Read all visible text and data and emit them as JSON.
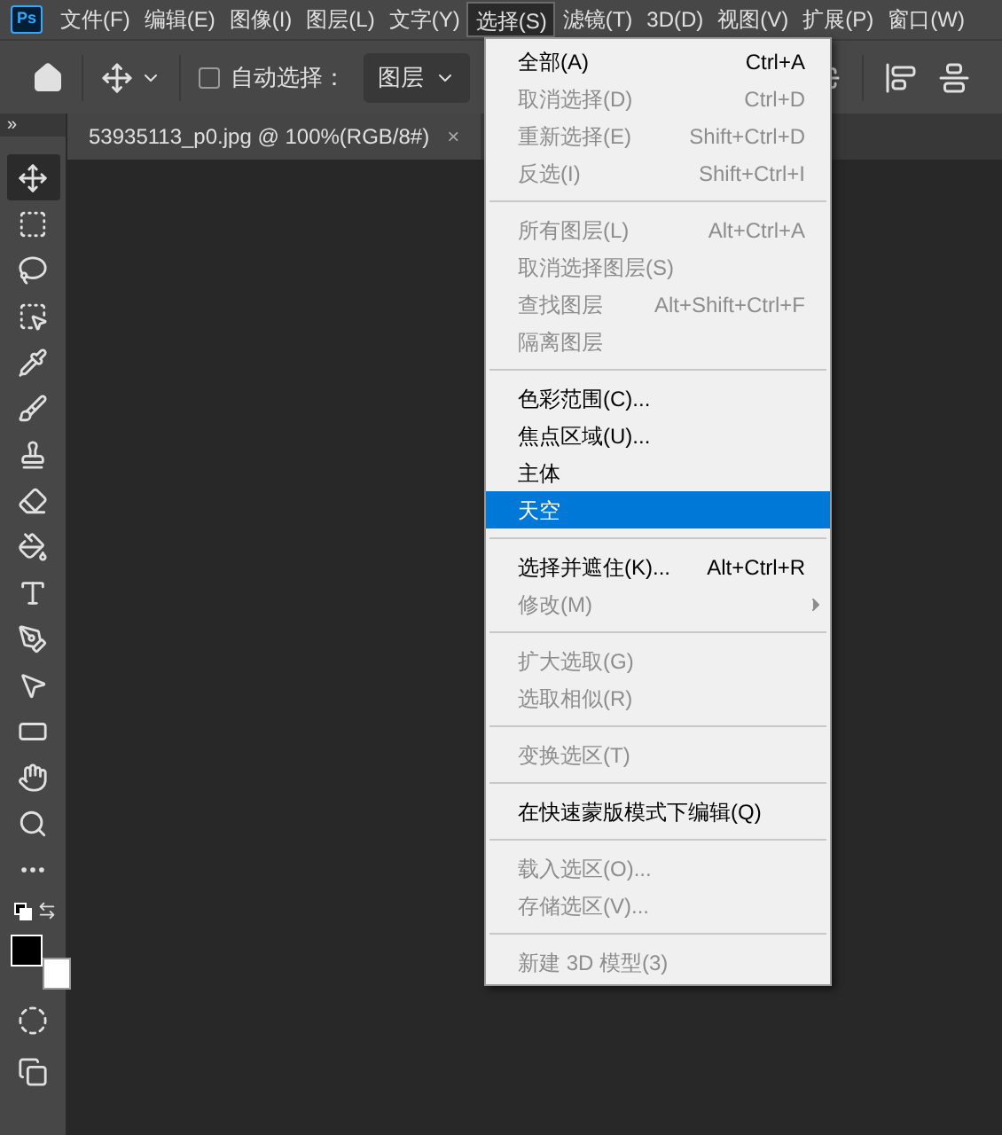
{
  "app_logo": "Ps",
  "menu_bar": [
    {
      "label": "文件(F)",
      "selected": false
    },
    {
      "label": "编辑(E)",
      "selected": false
    },
    {
      "label": "图像(I)",
      "selected": false
    },
    {
      "label": "图层(L)",
      "selected": false
    },
    {
      "label": "文字(Y)",
      "selected": false
    },
    {
      "label": "选择(S)",
      "selected": true
    },
    {
      "label": "滤镜(T)",
      "selected": false
    },
    {
      "label": "3D(D)",
      "selected": false
    },
    {
      "label": "视图(V)",
      "selected": false
    },
    {
      "label": "扩展(P)",
      "selected": false
    },
    {
      "label": "窗口(W)",
      "selected": false
    }
  ],
  "options_bar": {
    "auto_select": {
      "label": "自动选择：",
      "checked": false
    },
    "target": {
      "value": "图层"
    }
  },
  "panel_toggle": "»",
  "document_tab": {
    "title": "53935113_p0.jpg @ 100%(RGB/8#)",
    "close": "×"
  },
  "tools": [
    {
      "kind": "move",
      "selected": true
    },
    {
      "kind": "marquee",
      "selected": false
    },
    {
      "kind": "lasso",
      "selected": false
    },
    {
      "kind": "object",
      "selected": false
    },
    {
      "kind": "eyedropper",
      "selected": false
    },
    {
      "kind": "brush",
      "selected": false
    },
    {
      "kind": "stamp",
      "selected": false
    },
    {
      "kind": "eraser",
      "selected": false
    },
    {
      "kind": "bucket",
      "selected": false
    },
    {
      "kind": "type",
      "selected": false
    },
    {
      "kind": "pen",
      "selected": false
    },
    {
      "kind": "pointer",
      "selected": false
    },
    {
      "kind": "rectangle",
      "selected": false
    },
    {
      "kind": "hand",
      "selected": false
    },
    {
      "kind": "zoom",
      "selected": false
    },
    {
      "kind": "more",
      "selected": false
    }
  ],
  "color_swatches": [
    {
      "kind": "foreground",
      "color": "#000000"
    },
    {
      "kind": "background",
      "color": "#ffffff"
    }
  ],
  "select_menu": [
    {
      "kind": "item",
      "label": "全部(A)",
      "shortcut": "Ctrl+A",
      "disabled": false,
      "selected": false
    },
    {
      "kind": "item",
      "label": "取消选择(D)",
      "shortcut": "Ctrl+D",
      "disabled": true,
      "selected": false
    },
    {
      "kind": "item",
      "label": "重新选择(E)",
      "shortcut": "Shift+Ctrl+D",
      "disabled": true,
      "selected": false
    },
    {
      "kind": "item",
      "label": "反选(I)",
      "shortcut": "Shift+Ctrl+I",
      "disabled": true,
      "selected": false
    },
    {
      "kind": "separator"
    },
    {
      "kind": "item",
      "label": "所有图层(L)",
      "shortcut": "Alt+Ctrl+A",
      "disabled": true,
      "selected": false
    },
    {
      "kind": "item",
      "label": "取消选择图层(S)",
      "disabled": true,
      "selected": false
    },
    {
      "kind": "item",
      "label": "查找图层",
      "shortcut": "Alt+Shift+Ctrl+F",
      "disabled": true,
      "selected": false
    },
    {
      "kind": "item",
      "label": "隔离图层",
      "disabled": true,
      "selected": false
    },
    {
      "kind": "separator"
    },
    {
      "kind": "item",
      "label": "色彩范围(C)...",
      "disabled": false,
      "selected": false
    },
    {
      "kind": "item",
      "label": "焦点区域(U)...",
      "disabled": false,
      "selected": false
    },
    {
      "kind": "item",
      "label": "主体",
      "disabled": false,
      "selected": false
    },
    {
      "kind": "item",
      "label": "天空",
      "disabled": false,
      "selected": true
    },
    {
      "kind": "separator"
    },
    {
      "kind": "item",
      "label": "选择并遮住(K)...",
      "shortcut": "Alt+Ctrl+R",
      "disabled": false,
      "selected": false
    },
    {
      "kind": "item",
      "label": "修改(M)",
      "disabled": true,
      "selected": false,
      "submenu": true
    },
    {
      "kind": "separator"
    },
    {
      "kind": "item",
      "label": "扩大选取(G)",
      "disabled": true,
      "selected": false
    },
    {
      "kind": "item",
      "label": "选取相似(R)",
      "disabled": true,
      "selected": false
    },
    {
      "kind": "separator"
    },
    {
      "kind": "item",
      "label": "变换选区(T)",
      "disabled": true,
      "selected": false
    },
    {
      "kind": "separator"
    },
    {
      "kind": "item",
      "label": "在快速蒙版模式下编辑(Q)",
      "disabled": false,
      "selected": false
    },
    {
      "kind": "separator"
    },
    {
      "kind": "item",
      "label": "载入选区(O)...",
      "disabled": true,
      "selected": false
    },
    {
      "kind": "item",
      "label": "存储选区(V)...",
      "disabled": true,
      "selected": false
    },
    {
      "kind": "separator"
    },
    {
      "kind": "item",
      "label": "新建 3D 模型(3)",
      "disabled": true,
      "selected": false
    }
  ]
}
